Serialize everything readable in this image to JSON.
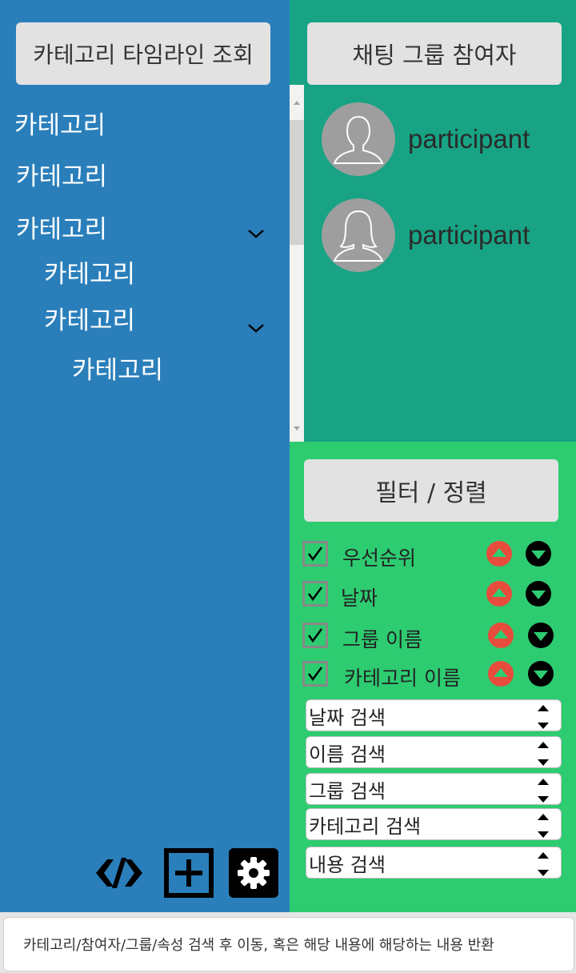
{
  "left_panel": {
    "timeline_button": "카테고리 타임라인 조회",
    "categories": [
      {
        "label": "카테고리"
      },
      {
        "label": "카테고리"
      },
      {
        "label": "카테고리"
      },
      {
        "label": "카테고리"
      },
      {
        "label": "카테고리"
      },
      {
        "label": "카테고리"
      }
    ],
    "bottom_icons": [
      "code-icon",
      "add-square-icon",
      "gear-icon"
    ]
  },
  "chat_group": {
    "title": "채팅 그룹 참여자",
    "participants": [
      {
        "name": "participant",
        "avatar": "male-avatar-icon"
      },
      {
        "name": "participant",
        "avatar": "female-avatar-icon"
      }
    ]
  },
  "filter": {
    "title": "필터 / 정렬",
    "options": [
      {
        "label": "우선순위",
        "checked": true
      },
      {
        "label": "날짜",
        "checked": true
      },
      {
        "label": "그룹 이름",
        "checked": true
      },
      {
        "label": "카테고리 이름",
        "checked": true
      }
    ],
    "searches": [
      {
        "label": "날짜 검색"
      },
      {
        "label": "이름 검색"
      },
      {
        "label": "그룹 검색"
      },
      {
        "label": "카테고리 검색"
      },
      {
        "label": "내용 검색"
      }
    ]
  },
  "bottom_bar": {
    "text": "카테고리/참여자/그룹/속성 검색 후 이동,  혹은 해당 내용에 해당하는 내용 반환"
  },
  "colors": {
    "left_bg": "#2a7fbb",
    "chat_bg": "#17a384",
    "filter_bg": "#2ecc71",
    "sort_up": "#e74c3c",
    "sort_down": "#000000"
  }
}
